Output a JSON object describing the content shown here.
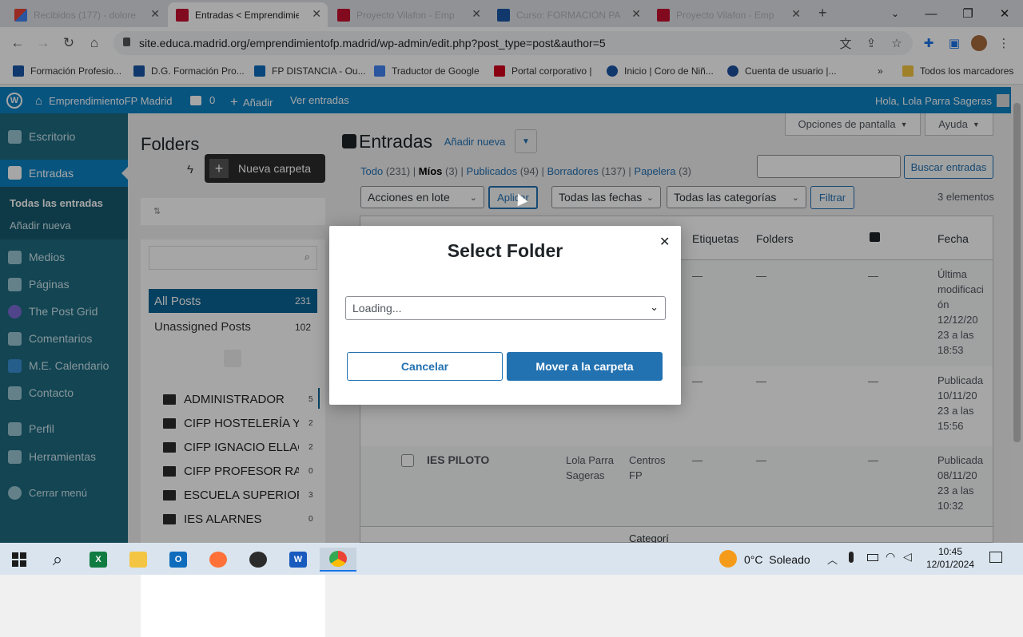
{
  "browser": {
    "tabs": [
      {
        "title": "Recibidos (177) - dolore",
        "active": false
      },
      {
        "title": "Entradas < Emprendimie",
        "active": true
      },
      {
        "title": "Proyecto Vilafon - Emp",
        "active": false
      },
      {
        "title": "Curso: FORMACIÓN PA",
        "active": false
      },
      {
        "title": "Proyecto Vilafon - Emp",
        "active": false
      }
    ],
    "url": "site.educa.madrid.org/emprendimientofp.madrid/wp-admin/edit.php?post_type=post&author=5",
    "bookmarks": [
      "Formación Profesio...",
      "D.G. Formación Pro...",
      "FP DISTANCIA - Ou...",
      "Traductor de Google",
      "Portal corporativo |",
      "Inicio | Coro de Niñ...",
      "Cuenta de usuario |..."
    ],
    "bookmarks_more": "»",
    "all_bookmarks": "Todos los marcadores"
  },
  "adminbar": {
    "site_name": "EmprendimientoFP Madrid",
    "comments_count": "0",
    "add_new": "Añadir",
    "view_posts": "Ver entradas",
    "greeting": "Hola, Lola Parra Sageras"
  },
  "sidebar": {
    "items": [
      {
        "label": "Escritorio"
      },
      {
        "label": "Entradas"
      },
      {
        "label": "Medios"
      },
      {
        "label": "Páginas"
      },
      {
        "label": "The Post Grid"
      },
      {
        "label": "Comentarios"
      },
      {
        "label": "M.E. Calendario"
      },
      {
        "label": "Contacto"
      },
      {
        "label": "Perfil"
      },
      {
        "label": "Herramientas"
      },
      {
        "label": "Cerrar menú"
      }
    ],
    "submenu": [
      "Todas las entradas",
      "Añadir nueva"
    ]
  },
  "folders": {
    "title": "Folders",
    "new_folder": "Nueva carpeta",
    "all_posts": {
      "label": "All Posts",
      "count": "231"
    },
    "unassigned": {
      "label": "Unassigned Posts",
      "count": "102"
    },
    "list": [
      {
        "name": "ADMINISTRADOR",
        "count": "5"
      },
      {
        "name": "CIFP HOSTELERÍA Y TU",
        "count": "2"
      },
      {
        "name": "CIFP IGNACIO ELLACU",
        "count": "2"
      },
      {
        "name": "CIFP PROFESOR RAÚL",
        "count": "0"
      },
      {
        "name": "ESCUELA SUPERIOR D",
        "count": "3"
      },
      {
        "name": "IES ALARNES",
        "count": "0"
      }
    ]
  },
  "main": {
    "title": "Entradas",
    "add_new": "Añadir nueva",
    "screen_options": "Opciones de pantalla",
    "help": "Ayuda",
    "filters": [
      {
        "label": "Todo",
        "count": "(231)"
      },
      {
        "label": "Míos",
        "count": "(3)"
      },
      {
        "label": "Publicados",
        "count": "(94)"
      },
      {
        "label": "Borradores",
        "count": "(137)"
      },
      {
        "label": "Papelera",
        "count": "(3)"
      }
    ],
    "search_button": "Buscar entradas",
    "bulk_actions": "Acciones en lote",
    "apply": "Aplicar",
    "all_dates": "Todas las fechas",
    "all_categories": "Todas las categorías",
    "filter": "Filtrar",
    "item_count": "3 elementos",
    "columns": {
      "tags": "Etiquetas",
      "folders": "Folders",
      "date": "Fecha"
    },
    "rows": [
      {
        "title": "",
        "author": "",
        "category": "",
        "tags": "—",
        "folders": "—",
        "comments": "—",
        "date": [
          "Última",
          "modificaci",
          "ón",
          "12/12/20",
          "23 a las",
          "18:53"
        ]
      },
      {
        "title": "",
        "author": "",
        "category": "",
        "tags": "—",
        "folders": "—",
        "comments": "—",
        "date": [
          "Publicada",
          "10/11/20",
          "23 a las",
          "15:56"
        ]
      },
      {
        "title": "IES PILOTO",
        "author": [
          "Lola Parra",
          "Sageras"
        ],
        "category": [
          "Centros",
          "FP"
        ],
        "tags": "—",
        "folders": "—",
        "comments": "—",
        "date": [
          "Publicada",
          "08/11/20",
          "23 a las",
          "10:32"
        ]
      }
    ],
    "footer_category": "Categorí"
  },
  "modal": {
    "title": "Select Folder",
    "select_value": "Loading...",
    "cancel": "Cancelar",
    "move": "Mover a la carpeta"
  },
  "taskbar": {
    "weather": "0°C  Soleado",
    "time": "10:45",
    "date": "12/01/2024"
  },
  "colors": {
    "wp_blue": "#2271b1",
    "sidebar": "#1e6a80",
    "adminbar": "#0b82c4"
  }
}
